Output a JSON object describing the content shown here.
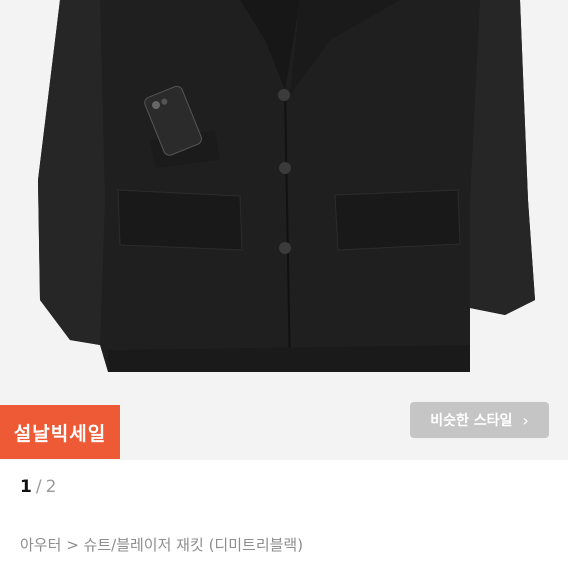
{
  "badge": {
    "label": "설날빅세일"
  },
  "similar_style": {
    "label": "비슷한 스타일",
    "icon": "chevron-right-icon"
  },
  "pagination": {
    "current": "1",
    "separator": "/",
    "total": "2"
  },
  "breadcrumb": {
    "category": "아우터",
    "arrow": ">",
    "subcategory": "슈트/블레이저 재킷",
    "variant": "(디미트리블랙)"
  },
  "colors": {
    "badge": "#ee5a36",
    "jacket": "#1e1e1e",
    "background": "#f3f3f3"
  }
}
